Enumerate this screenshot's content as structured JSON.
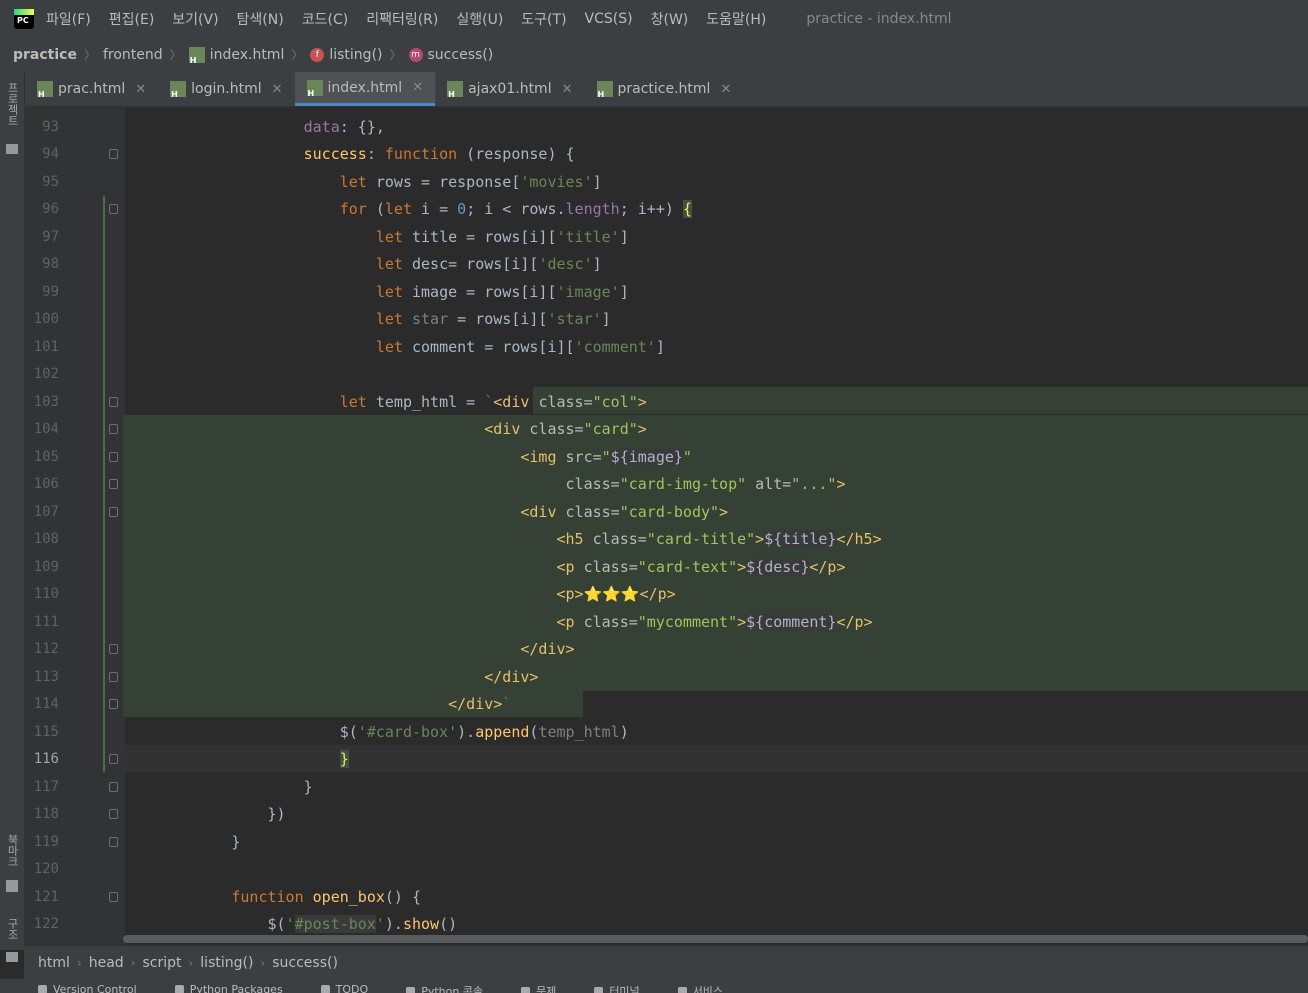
{
  "menubar": {
    "items": [
      "파일(F)",
      "편집(E)",
      "보기(V)",
      "탐색(N)",
      "코드(C)",
      "리팩터링(R)",
      "실행(U)",
      "도구(T)",
      "VCS(S)",
      "창(W)",
      "도움말(H)"
    ],
    "window_title": "practice - index.html"
  },
  "navbar": {
    "project": "practice",
    "folder": "frontend",
    "file": "index.html",
    "function": "listing()",
    "method": "success()"
  },
  "side": {
    "project_label": "프로젝트",
    "bookmarks_label": "북마크",
    "structure_label": "구조"
  },
  "tabs": [
    {
      "label": "prac.html",
      "active": false
    },
    {
      "label": "login.html",
      "active": false
    },
    {
      "label": "index.html",
      "active": true
    },
    {
      "label": "ajax01.html",
      "active": false
    },
    {
      "label": "practice.html",
      "active": false
    }
  ],
  "editor": {
    "current_line": 116,
    "lines": [
      {
        "n": "93"
      },
      {
        "n": "94"
      },
      {
        "n": "95"
      },
      {
        "n": "96"
      },
      {
        "n": "97"
      },
      {
        "n": "98"
      },
      {
        "n": "99"
      },
      {
        "n": "100"
      },
      {
        "n": "101"
      },
      {
        "n": "102"
      },
      {
        "n": "103"
      },
      {
        "n": "104"
      },
      {
        "n": "105"
      },
      {
        "n": "106"
      },
      {
        "n": "107"
      },
      {
        "n": "108"
      },
      {
        "n": "109"
      },
      {
        "n": "110"
      },
      {
        "n": "111"
      },
      {
        "n": "112"
      },
      {
        "n": "113"
      },
      {
        "n": "114"
      },
      {
        "n": "115"
      },
      {
        "n": "116"
      },
      {
        "n": "117"
      },
      {
        "n": "118"
      },
      {
        "n": "119"
      },
      {
        "n": "120"
      },
      {
        "n": "121"
      },
      {
        "n": "122"
      }
    ]
  },
  "bottom_breadcrumb": [
    "html",
    "head",
    "script",
    "listing()",
    "success()"
  ],
  "toolwindows": [
    "Version Control",
    "Python Packages",
    "TODO",
    "Python 콘솔",
    "문제",
    "터미널",
    "서비스"
  ],
  "colors": {
    "editor_bg": "#2b2b2b",
    "keyword": "#cc7832",
    "string": "#6a8759",
    "tag": "#e8bf6a",
    "injected_highlight": "#344134",
    "accent": "#4a88c7"
  }
}
